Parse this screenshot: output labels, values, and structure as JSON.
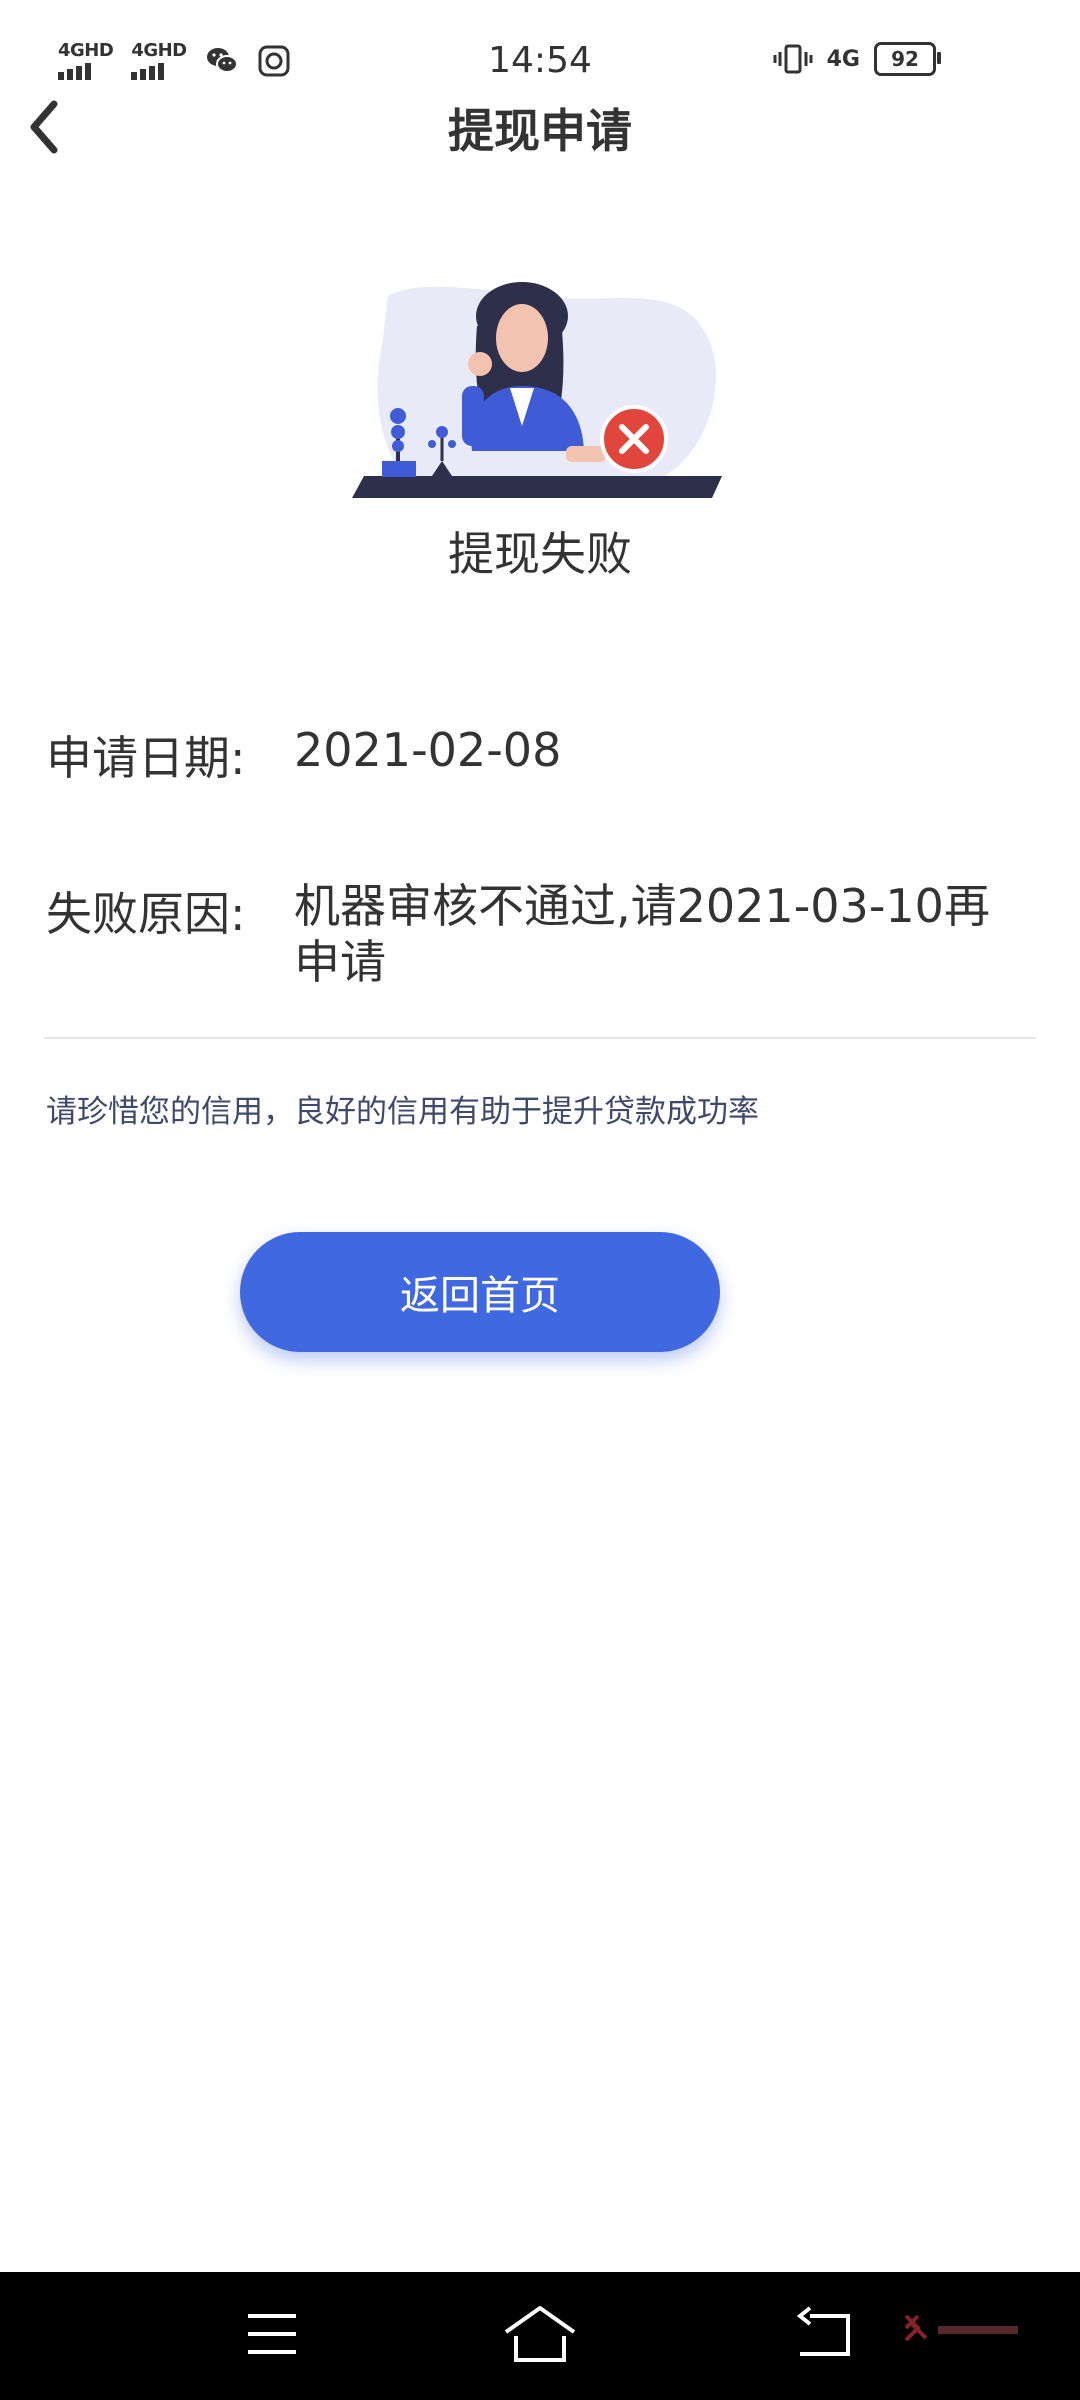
{
  "status_bar": {
    "network_1": "4GHD",
    "network_2": "4GHD",
    "time": "14:54",
    "network_type": "4G",
    "battery": "92"
  },
  "header": {
    "title": "提现申请"
  },
  "result": {
    "title": "提现失败"
  },
  "details": {
    "date_label": "申请日期:",
    "date_value": "2021-02-08",
    "reason_label": "失败原因:",
    "reason_value": "机器审核不通过,请2021-03-10再申请"
  },
  "notice": "请珍惜您的信用，良好的信用有助于提升贷款成功率",
  "actions": {
    "home_button": "返回首页"
  },
  "colors": {
    "accent": "#4068e1",
    "error": "#e0463c",
    "text": "#333333",
    "notice": "#3f4a6a"
  }
}
